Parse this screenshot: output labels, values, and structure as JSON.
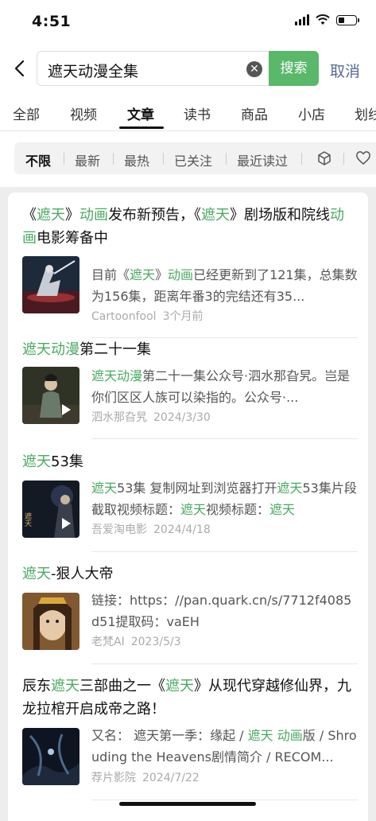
{
  "status": {
    "time": "4:51"
  },
  "search": {
    "query": "遮天动漫全集",
    "button": "搜索",
    "cancel": "取消"
  },
  "tabs": [
    {
      "label": "全部",
      "active": false
    },
    {
      "label": "视频",
      "active": false
    },
    {
      "label": "文章",
      "active": true
    },
    {
      "label": "读书",
      "active": false
    },
    {
      "label": "商品",
      "active": false
    },
    {
      "label": "小店",
      "active": false
    },
    {
      "label": "划线",
      "active": false
    }
  ],
  "filters": [
    {
      "label": "不限",
      "active": true
    },
    {
      "label": "最新",
      "active": false
    },
    {
      "label": "最热",
      "active": false
    },
    {
      "label": "已关注",
      "active": false
    },
    {
      "label": "最近读过",
      "active": false
    }
  ],
  "filter_icons": [
    "box-icon",
    "heart-icon"
  ],
  "accent": "#4aa961",
  "results": [
    {
      "title_parts": [
        "《",
        "遮天",
        "》",
        "动画",
        "发布新预告，《",
        "遮天",
        "》剧场版和院线",
        "动画",
        "电影筹备中"
      ],
      "title_hl": [
        false,
        true,
        false,
        true,
        false,
        true,
        false,
        true,
        false
      ],
      "snippet_parts": [
        "目前《",
        "遮天",
        "》",
        "动画",
        "已经更新到了121集，总集数为156集，距离年番3的完结还有35..."
      ],
      "snippet_hl": [
        false,
        true,
        false,
        true,
        false
      ],
      "source": "Cartoonfool",
      "date": "3个月前",
      "video": false
    },
    {
      "title_parts": [
        "遮天动漫",
        "第二十一集"
      ],
      "title_hl": [
        true,
        false
      ],
      "snippet_parts": [
        "遮天动漫",
        "第二十一集公众号·泗水那旮旯。岂是你们区区人族可以染指的。公众号·..."
      ],
      "snippet_hl": [
        true,
        false
      ],
      "source": "泗水那旮旯",
      "date": "2024/3/30",
      "video": true
    },
    {
      "title_parts": [
        "遮天",
        "53集"
      ],
      "title_hl": [
        true,
        false
      ],
      "snippet_parts": [
        "遮天",
        "53集 复制网址到浏览器打开",
        "遮天",
        "53集片段截取视频标题：",
        "遮天",
        "视频标题：",
        "遮天"
      ],
      "snippet_hl": [
        true,
        false,
        true,
        false,
        true,
        false,
        true
      ],
      "source": "吾爱淘电影",
      "date": "2024/4/18",
      "video": true
    },
    {
      "title_parts": [
        "遮天",
        "-狠人大帝"
      ],
      "title_hl": [
        true,
        false
      ],
      "snippet_parts": [
        "链接：https：//pan.quark.cn/s/7712f4085d51提取码：vaEH"
      ],
      "snippet_hl": [
        false
      ],
      "source": "老梵AI",
      "date": "2023/5/3",
      "video": false
    },
    {
      "title_parts": [
        "辰东",
        "遮天",
        "三部曲之一《",
        "遮天",
        "》从现代穿越修仙界，九龙拉棺开启成帝之路！"
      ],
      "title_hl": [
        false,
        true,
        false,
        true,
        false
      ],
      "snippet_parts": [
        "又名：  遮天第一季：缘起 / ",
        "遮天 动画",
        "版 / Shrouding the Heavens剧情简介 / RECOM..."
      ],
      "snippet_hl": [
        false,
        true,
        false
      ],
      "source": "荐片影院",
      "date": "2024/7/22",
      "video": false
    }
  ]
}
